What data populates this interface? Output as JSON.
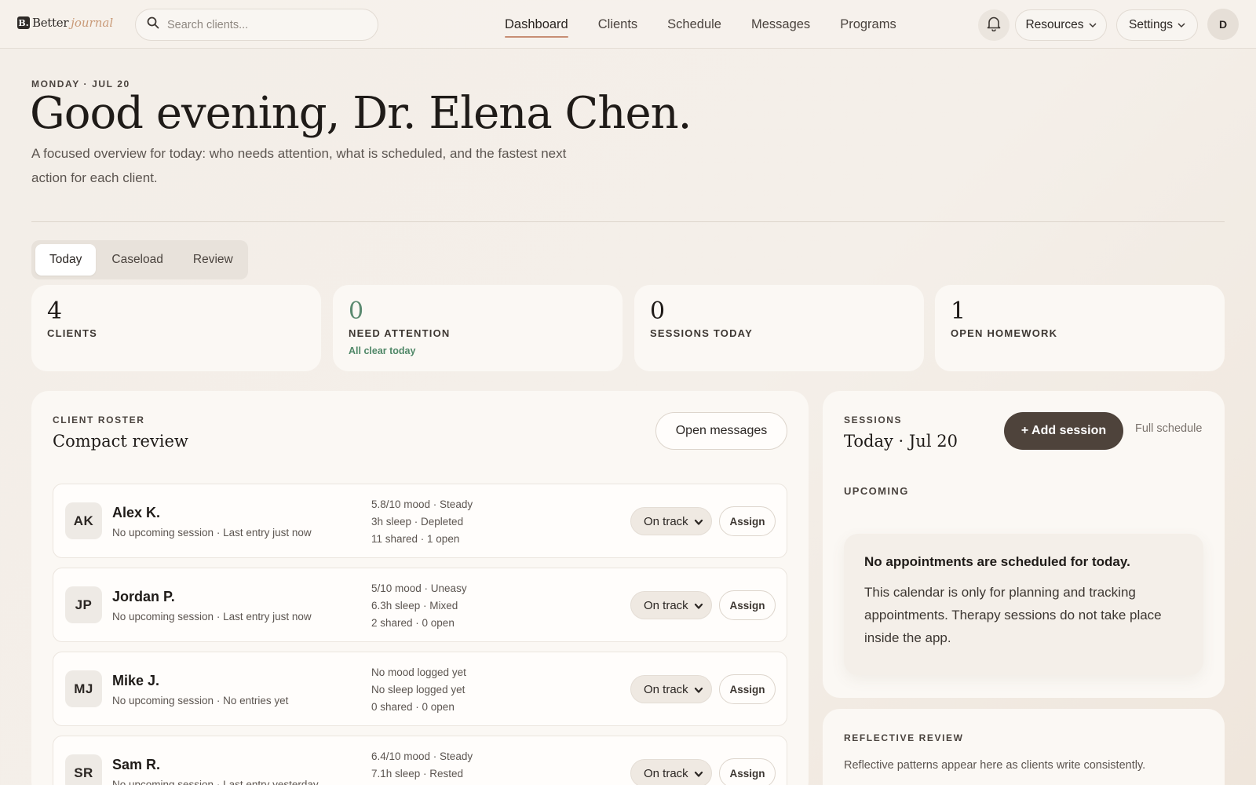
{
  "brand": {
    "mark": "B.",
    "name": "Better",
    "accent": "journal"
  },
  "search": {
    "placeholder": "Search clients..."
  },
  "nav": [
    {
      "label": "Dashboard",
      "active": true
    },
    {
      "label": "Clients"
    },
    {
      "label": "Schedule"
    },
    {
      "label": "Messages"
    },
    {
      "label": "Programs"
    }
  ],
  "header_actions": {
    "resources": "Resources",
    "settings": "Settings",
    "avatar": "D"
  },
  "hero": {
    "date": "MONDAY · JUL 20",
    "greeting": "Good evening, Dr. Elena Chen.",
    "subtitle": "A focused overview for today: who needs attention, what is scheduled, and the fastest next action for each client."
  },
  "tabs": [
    {
      "label": "Today",
      "active": true
    },
    {
      "label": "Caseload"
    },
    {
      "label": "Review"
    }
  ],
  "stats": [
    {
      "value": "4",
      "label": "CLIENTS",
      "note": ""
    },
    {
      "value": "0",
      "label": "NEED ATTENTION",
      "note": "All clear today"
    },
    {
      "value": "0",
      "label": "SESSIONS TODAY",
      "note": ""
    },
    {
      "value": "1",
      "label": "OPEN HOMEWORK",
      "note": ""
    }
  ],
  "roster": {
    "kicker": "CLIENT ROSTER",
    "title": "Compact review",
    "open_messages": "Open messages",
    "clients": [
      {
        "initials": "AK",
        "name": "Alex K.",
        "sub": "No upcoming session · Last entry just now",
        "metrics": [
          "5.8/10 mood · Steady",
          "3h sleep · Depleted",
          "11 shared · 1 open"
        ],
        "status": "On track",
        "action": "Assign"
      },
      {
        "initials": "JP",
        "name": "Jordan P.",
        "sub": "No upcoming session · Last entry just now",
        "metrics": [
          "5/10 mood · Uneasy",
          "6.3h sleep · Mixed",
          "2 shared · 0 open"
        ],
        "status": "On track",
        "action": "Assign"
      },
      {
        "initials": "MJ",
        "name": "Mike J.",
        "sub": "No upcoming session · No entries yet",
        "metrics": [
          "No mood logged yet",
          "No sleep logged yet",
          "0 shared · 0 open"
        ],
        "status": "On track",
        "action": "Assign"
      },
      {
        "initials": "SR",
        "name": "Sam R.",
        "sub": "No upcoming session · Last entry yesterday",
        "metrics": [
          "6.4/10 mood · Steady",
          "7.1h sleep · Rested",
          ""
        ],
        "status": "On track",
        "action": "Assign"
      }
    ]
  },
  "sessions": {
    "kicker": "SESSIONS",
    "title": "Today · Jul 20",
    "add": "+ Add session",
    "full_schedule": "Full schedule",
    "upcoming": "UPCOMING",
    "empty_title": "No appointments are scheduled for today.",
    "empty_body": "This calendar is only for planning and tracking appointments. Therapy sessions do not take place inside the app."
  },
  "reflective": {
    "kicker": "REFLECTIVE REVIEW",
    "body": "Reflective patterns appear here as clients write consistently."
  }
}
